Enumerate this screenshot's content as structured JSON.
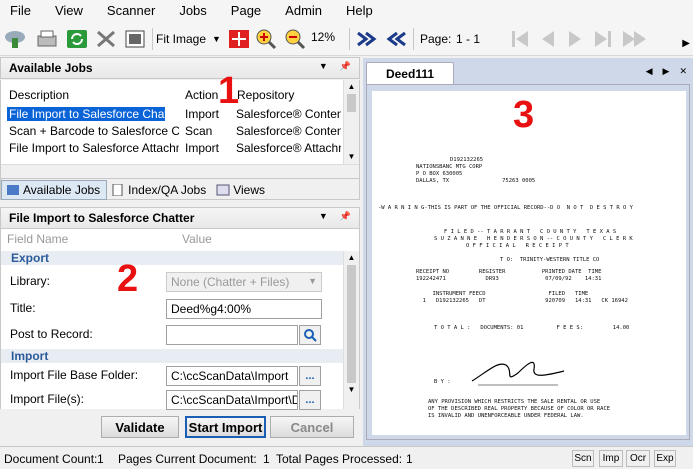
{
  "menu": [
    "File",
    "View",
    "Scanner",
    "Jobs",
    "Page",
    "Admin",
    "Help"
  ],
  "toolbar": {
    "fit_label": "Fit Image",
    "zoom_value": "12%",
    "page_label": "Page:",
    "page_value": "1 - 1"
  },
  "available_jobs": {
    "title": "Available Jobs",
    "columns": [
      "Description",
      "Action",
      "Repository"
    ],
    "rows": [
      {
        "description": "File Import to Salesforce Chatter",
        "action": "Import",
        "repository": "Salesforce® Content"
      },
      {
        "description": "Scan + Barcode to Salesforce Co...",
        "action": "Scan",
        "repository": "Salesforce® Content"
      },
      {
        "description": "File Import to Salesforce Attachm...",
        "action": "Import",
        "repository": "Salesforce® Attachm..."
      }
    ]
  },
  "tabs": [
    "Available Jobs",
    "Index/QA Jobs",
    "Views"
  ],
  "job_props": {
    "title": "File Import to Salesforce Chatter",
    "col_field": "Field Name",
    "col_value": "Value",
    "section_export": "Export",
    "library_label": "Library:",
    "library_value": "None (Chatter + Files)",
    "title_label": "Title:",
    "title_value": "Deed%g4:00%",
    "post_label": "Post to Record:",
    "post_value": "",
    "section_import": "Import",
    "base_folder_label": "Import File Base Folder:",
    "base_folder_value": "C:\\ccScanData\\Import",
    "files_label": "Import File(s):",
    "files_value": "C:\\ccScanData\\Import\\De",
    "browse": "..."
  },
  "buttons": {
    "validate": "Validate",
    "start": "Start Import",
    "cancel": "Cancel"
  },
  "doc": {
    "tab": "Deed111",
    "lines": [
      "D192132265",
      "NATIONSBANC MTG CORP",
      "P O BOX 630005",
      "DALLAS, TX                75263 0005"
    ],
    "warning": "-W A R N I N G-THIS IS PART OF THE OFFICIAL RECORD--D O  N O T  D E S T R O Y",
    "filed1": "F I L E D -- T A R R A N T   C O U N T Y   T E X A S",
    "filed2": "S U Z A N N E   H E N D E R S O N -- C O U N T Y   C L E R K",
    "filed3": "O F F I C I A L   R E C E I P T",
    "to": "T O:  TRINITY-WESTERN TITLE CO",
    "receipt_head": "RECEIPT NO         REGISTER           PRINTED DATE  TIME",
    "receipt_vals": "192242471            DR93              07/09/92    14:31",
    "instr_head": "     INSTRUMENT FEECD                   FILED   TIME",
    "instr_vals": "  1   D192132265   DT                  920709   14:31   CK 16942",
    "total": "T O T A L :   DOCUMENTS: 01          F E E S:         14.00",
    "by": "B Y :",
    "prov1": "ANY PROVISION WHICH RESTRICTS THE SALE RENTAL OR USE",
    "prov2": "OF THE DESCRIBED REAL PROPERTY BECAUSE OF COLOR OR RACE",
    "prov3": "IS INVALID AND UNENFORCEABLE UNDER FEDERAL LAW."
  },
  "annotations": [
    "1",
    "2",
    "3"
  ],
  "status": {
    "doc_count_label": "Document Count:",
    "doc_count": "1",
    "pages_current_label": "Pages Current Document:",
    "pages_current": "1",
    "pages_processed_label": "Total Pages Processed:",
    "pages_processed": "1",
    "indicators": [
      "Scn",
      "Imp",
      "Ocr",
      "Exp"
    ]
  },
  "colors": {
    "accent": "#0a64d8",
    "annotation": "#e81010",
    "doc_bg": "#ced8e8"
  }
}
